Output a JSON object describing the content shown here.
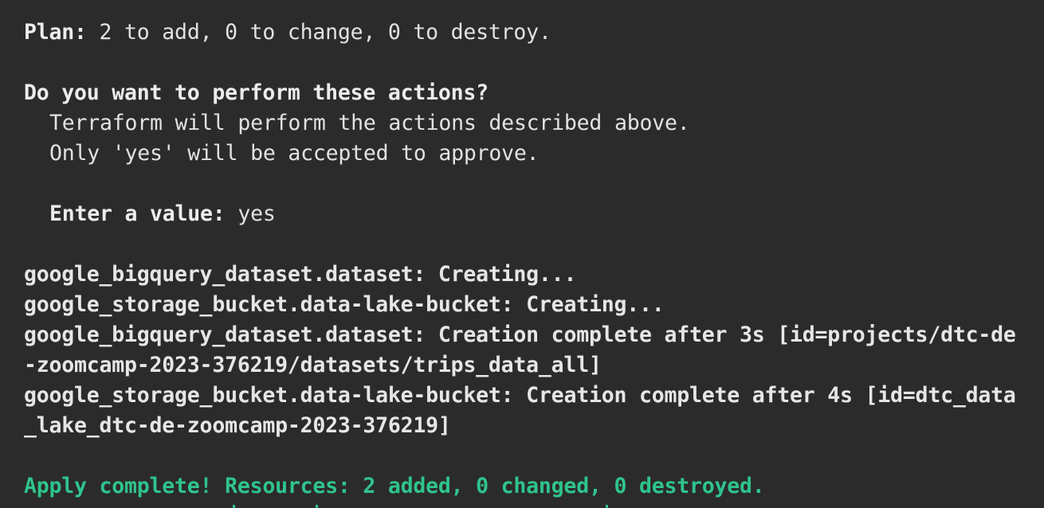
{
  "terminal": {
    "plan": {
      "label": "Plan:",
      "text": " 2 to add, 0 to change, 0 to destroy."
    },
    "prompt": {
      "question": "Do you want to perform these actions?",
      "line1": "Terraform will perform the actions described above.",
      "line2": "Only 'yes' will be accepted to approve."
    },
    "input": {
      "label": "Enter a value:",
      "value": " yes"
    },
    "log": [
      {
        "resource": "google_bigquery_dataset.dataset:",
        "message": " Creating..."
      },
      {
        "resource": "google_storage_bucket.data-lake-bucket:",
        "message": " Creating..."
      },
      {
        "resource": "google_bigquery_dataset.dataset:",
        "message": " Creation complete after 3s [id=projects/dtc-de"
      },
      {
        "continuation": "-zoomcamp-2023-376219/datasets/trips_data_all]"
      },
      {
        "resource": "google_storage_bucket.data-lake-bucket:",
        "message": " Creation complete after 4s [id=dtc_data"
      },
      {
        "continuation": "_lake_dtc-de-zoomcamp-2023-376219]"
      }
    ],
    "result": "Apply complete! Resources: 2 added, 0 changed, 0 destroyed.",
    "colors": {
      "background": "#2b2b2b",
      "text": "#e2e2e2",
      "success": "#2fc48d"
    }
  }
}
